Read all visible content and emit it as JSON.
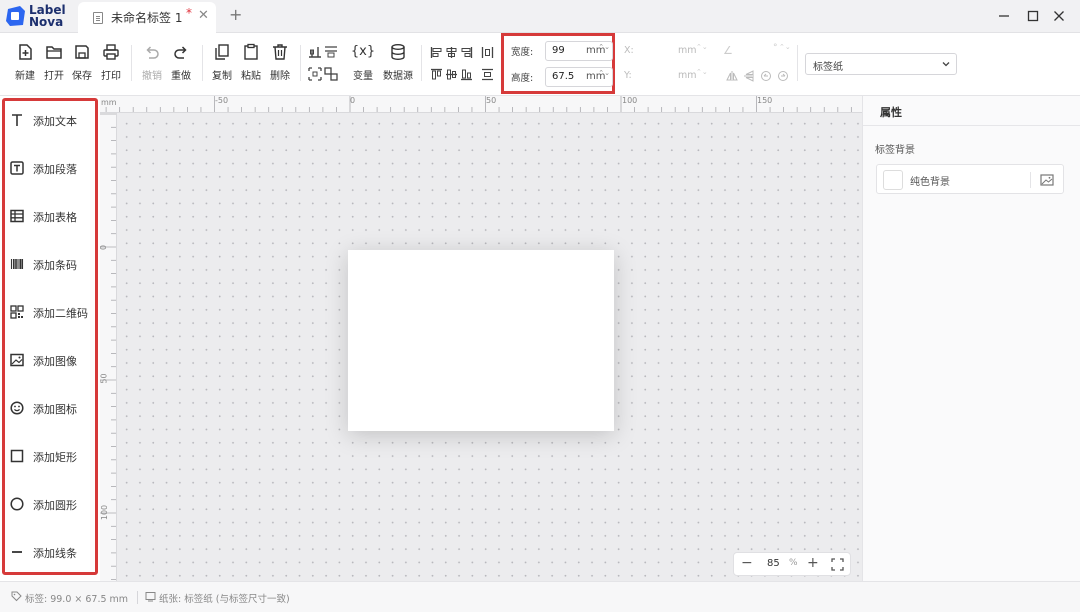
{
  "app": {
    "logo_line1": "Label",
    "logo_line2": "Nova",
    "brand_color": "#2c66f0",
    "accent_red": "#d63a3a"
  },
  "tab": {
    "title": "未命名标签 1",
    "modified_marker": "*",
    "close_glyph": "✕",
    "add_glyph": "+"
  },
  "toolbar": {
    "new_label": "新建",
    "open_label": "打开",
    "save_label": "保存",
    "print_label": "打印",
    "undo_label": "撤销",
    "redo_label": "重做",
    "copy_label": "复制",
    "paste_label": "粘贴",
    "delete_label": "删除",
    "variable_label": "变量",
    "datasource_label": "数据源",
    "variable_glyph": "{x}"
  },
  "dimensions": {
    "width_label": "宽度:",
    "width_value": "99",
    "height_label": "高度:",
    "height_value": "67.5",
    "unit": "mm",
    "spin_glyph": "⌃⌄"
  },
  "position": {
    "x_label": "X:",
    "y_label": "Y:",
    "unit": "mm",
    "angle_glyph": "∠",
    "angle_unit": "°"
  },
  "paper_select": {
    "selected": "标签纸"
  },
  "sidebar": {
    "items": [
      {
        "label": "添加文本",
        "icon": "text-icon"
      },
      {
        "label": "添加段落",
        "icon": "paragraph-icon"
      },
      {
        "label": "添加表格",
        "icon": "table-icon"
      },
      {
        "label": "添加条码",
        "icon": "barcode-icon"
      },
      {
        "label": "添加二维码",
        "icon": "qrcode-icon"
      },
      {
        "label": "添加图像",
        "icon": "image-icon"
      },
      {
        "label": "添加图标",
        "icon": "smiley-icon"
      },
      {
        "label": "添加矩形",
        "icon": "rectangle-icon"
      },
      {
        "label": "添加圆形",
        "icon": "circle-icon"
      },
      {
        "label": "添加线条",
        "icon": "line-icon"
      }
    ]
  },
  "rulers": {
    "unit": "mm",
    "top_labels": [
      "-50",
      "0",
      "50",
      "100",
      "150"
    ],
    "left_labels": [
      "0",
      "50",
      "100"
    ]
  },
  "zoom": {
    "minus": "−",
    "value": "85",
    "percent": "%",
    "plus": "+"
  },
  "properties": {
    "title": "属性",
    "section_label": "标签背景",
    "background_option": "纯色背景"
  },
  "status": {
    "label_size": "标签: 99.0 × 67.5 mm",
    "paper_info": "纸张: 标签纸 (与标签尺寸一致)"
  }
}
